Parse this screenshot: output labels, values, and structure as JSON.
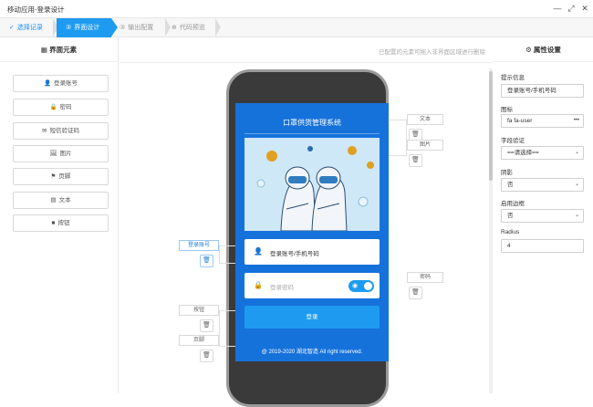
{
  "window": {
    "title": "移动应用-登录设计",
    "min": "—",
    "max": "⤢",
    "close": "✕"
  },
  "steps": [
    {
      "num": "✓",
      "label": "选择记录"
    },
    {
      "num": "②",
      "label": "界面设计"
    },
    {
      "num": "③",
      "label": "输出配置"
    },
    {
      "num": "⊕",
      "label": "代码预览"
    }
  ],
  "left_panel": {
    "title": "界面元素",
    "items": [
      {
        "icon": "👤",
        "label": "登录账号"
      },
      {
        "icon": "🔒",
        "label": "密码"
      },
      {
        "icon": "✉",
        "label": "短信验证码"
      },
      {
        "icon": "🖼",
        "label": "图片"
      },
      {
        "icon": "⚑",
        "label": "页脚"
      },
      {
        "icon": "▤",
        "label": "文本"
      },
      {
        "icon": "■",
        "label": "按钮"
      }
    ]
  },
  "canvas": {
    "hint": "已配置的元素可拖入非界面区域进行删除",
    "screen_title": "口罩供货管理系统",
    "account_placeholder": "登录账号/手机号码",
    "password_placeholder": "登录密码",
    "login_button": "登录",
    "footer": "@ 2019-2020 湖北智造 All right reserved."
  },
  "tags": {
    "text": "文本",
    "image": "图片",
    "account": "登录账号",
    "password": "密码",
    "button": "按钮",
    "footer": "页脚"
  },
  "right_panel": {
    "title": "属性设置",
    "fields": [
      {
        "label": "提示信息",
        "value": "登录账号/手机号码"
      },
      {
        "label": "图标",
        "value": "fa fa-user",
        "suffix": "•••"
      },
      {
        "label": "字段验证",
        "value": "==请选择==",
        "caret": "⌄"
      },
      {
        "label": "阴影",
        "value": "否",
        "caret": "⌄"
      },
      {
        "label": "启用边框",
        "value": "否",
        "caret": "⌄"
      },
      {
        "label": "Radius",
        "value": "4"
      }
    ]
  }
}
